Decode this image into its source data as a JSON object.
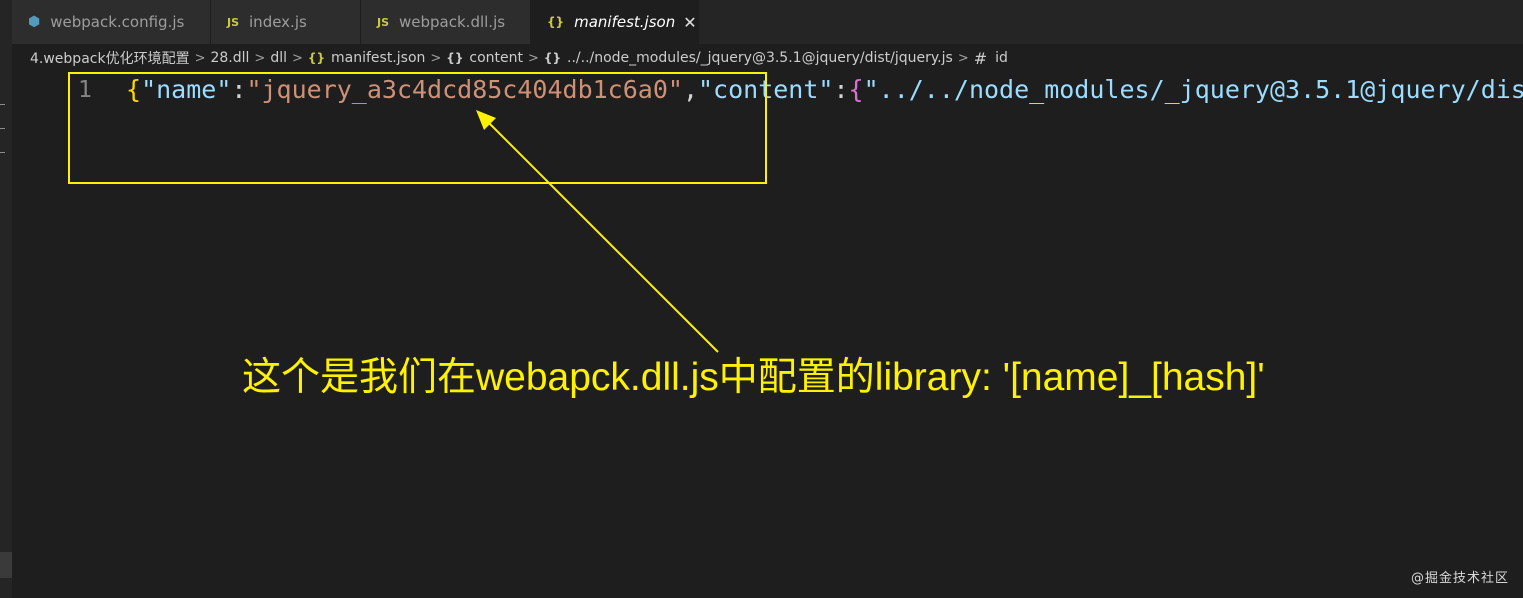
{
  "tabs": [
    {
      "icon": "webpack-icon",
      "label": "webpack.config.js",
      "active": false
    },
    {
      "icon": "js-icon",
      "icon_text": "JS",
      "label": "index.js",
      "active": false
    },
    {
      "icon": "js-icon",
      "icon_text": "JS",
      "label": "webpack.dll.js",
      "active": false
    },
    {
      "icon": "json-icon",
      "icon_text": "{}",
      "label": "manifest.json",
      "active": true,
      "close": "✕"
    }
  ],
  "breadcrumb": {
    "items": [
      "4.webpack优化环境配置",
      "28.dll",
      "dll",
      "manifest.json",
      "content",
      "../../node_modules/_jquery@3.5.1@jquery/dist/jquery.js",
      "id"
    ],
    "icon_json": "{}",
    "icon_obj": "{}",
    "icon_hash": "#"
  },
  "editor": {
    "line_number": "1",
    "tokens": {
      "open_brace": "{",
      "key_name": "\"name\"",
      "colon1": ":",
      "name_value": "\"jquery_a3c4dcd85c404db1c6a0\"",
      "comma": ",",
      "key_content": "\"content\"",
      "colon2": ":",
      "open_brace2": "{",
      "content_key": "\"../../node_modules/_jquery@3.5.1@jquery/dis"
    }
  },
  "annotation": {
    "text": "这个是我们在webapck.dll.js中配置的library: '[name]_[hash]'",
    "color": "#fff200"
  },
  "watermark": "@掘金技术社区",
  "colors": {
    "editor_bg": "#1e1e1e",
    "tab_bg": "#2d2d2d",
    "json_key": "#9cdcfe",
    "json_string": "#ce9178",
    "bracket_1": "#ffd700",
    "bracket_2": "#da70d6"
  }
}
